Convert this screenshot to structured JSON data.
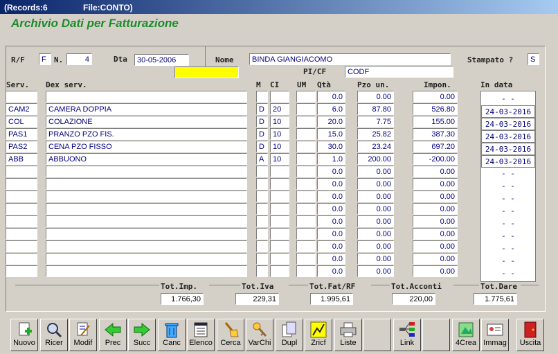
{
  "window": {
    "records": "(Records:6",
    "file": "File:CONTO)"
  },
  "heading": "Archivio Dati per Fatturazione",
  "header": {
    "rf_label": "R/F",
    "rf_value": "F",
    "n_label": "N.",
    "n_value": "4",
    "dta_label": "Dta",
    "dta_value": "30-05-2006",
    "nome_label": "Nome",
    "nome_value": "BINDA GIANGIACOMO",
    "stampato_label": "Stampato ?",
    "stampato_value": "S",
    "picf_label": "PI/CF",
    "picf_value": "CODF"
  },
  "columns": {
    "serv": "Serv.",
    "dex": "Dex serv.",
    "m": "M",
    "ci": "CI",
    "um": "UM",
    "qta": "Qtà",
    "pzo": "Pzo un.",
    "impon": "Impon.",
    "indata": "In data"
  },
  "rows": [
    {
      "serv": "",
      "dex": "",
      "m": "",
      "ci": "",
      "um": "",
      "qta": "0.0",
      "pzo": "0.00",
      "impon": "0.00",
      "date": "-  -"
    },
    {
      "serv": "CAM2",
      "dex": "CAMERA DOPPIA",
      "m": "D",
      "ci": "20",
      "um": "",
      "qta": "6.0",
      "pzo": "87.80",
      "impon": "526.80",
      "date": "24-03-2016"
    },
    {
      "serv": "COL",
      "dex": "COLAZIONE",
      "m": "D",
      "ci": "10",
      "um": "",
      "qta": "20.0",
      "pzo": "7.75",
      "impon": "155.00",
      "date": "24-03-2016"
    },
    {
      "serv": "PAS1",
      "dex": "PRANZO PZO FIS.",
      "m": "D",
      "ci": "10",
      "um": "",
      "qta": "15.0",
      "pzo": "25.82",
      "impon": "387.30",
      "date": "24-03-2016"
    },
    {
      "serv": "PAS2",
      "dex": "CENA PZO FISSO",
      "m": "D",
      "ci": "10",
      "um": "",
      "qta": "30.0",
      "pzo": "23.24",
      "impon": "697.20",
      "date": "24-03-2016"
    },
    {
      "serv": "ABB",
      "dex": "ABBUONO",
      "m": "A",
      "ci": "10",
      "um": "",
      "qta": "1.0",
      "pzo": "200.00",
      "impon": "-200.00",
      "date": "24-03-2016"
    },
    {
      "serv": "",
      "dex": "",
      "m": "",
      "ci": "",
      "um": "",
      "qta": "0.0",
      "pzo": "0.00",
      "impon": "0.00",
      "date": "-  -"
    },
    {
      "serv": "",
      "dex": "",
      "m": "",
      "ci": "",
      "um": "",
      "qta": "0.0",
      "pzo": "0.00",
      "impon": "0.00",
      "date": "-  -"
    },
    {
      "serv": "",
      "dex": "",
      "m": "",
      "ci": "",
      "um": "",
      "qta": "0.0",
      "pzo": "0.00",
      "impon": "0.00",
      "date": "-  -"
    },
    {
      "serv": "",
      "dex": "",
      "m": "",
      "ci": "",
      "um": "",
      "qta": "0.0",
      "pzo": "0.00",
      "impon": "0.00",
      "date": "-  -"
    },
    {
      "serv": "",
      "dex": "",
      "m": "",
      "ci": "",
      "um": "",
      "qta": "0.0",
      "pzo": "0.00",
      "impon": "0.00",
      "date": "-  -"
    },
    {
      "serv": "",
      "dex": "",
      "m": "",
      "ci": "",
      "um": "",
      "qta": "0.0",
      "pzo": "0.00",
      "impon": "0.00",
      "date": "-  -"
    },
    {
      "serv": "",
      "dex": "",
      "m": "",
      "ci": "",
      "um": "",
      "qta": "0.0",
      "pzo": "0.00",
      "impon": "0.00",
      "date": "-  -"
    },
    {
      "serv": "",
      "dex": "",
      "m": "",
      "ci": "",
      "um": "",
      "qta": "0.0",
      "pzo": "0.00",
      "impon": "0.00",
      "date": "-  -"
    },
    {
      "serv": "",
      "dex": "",
      "m": "",
      "ci": "",
      "um": "",
      "qta": "0.0",
      "pzo": "0.00",
      "impon": "0.00",
      "date": "-  -"
    }
  ],
  "totals": {
    "imp_label": "Tot.Imp.",
    "imp": "1.766,30",
    "iva_label": "Tot.Iva",
    "iva": "229,31",
    "fat_label": "Tot.Fat/RF",
    "fat": "1.995,61",
    "acconti_label": "Tot.Acconti",
    "acconti": "220,00",
    "dare_label": "Tot.Dare",
    "dare": "1.775,61"
  },
  "toolbar": [
    {
      "name": "nuovo-button",
      "icon": "new-doc-icon",
      "label": "Nuovo"
    },
    {
      "name": "ricer-button",
      "icon": "search-icon",
      "label": "Ricer"
    },
    {
      "name": "modif-button",
      "icon": "edit-icon",
      "label": "Modif"
    },
    {
      "name": "prec-button",
      "icon": "arrow-left-icon",
      "label": "Prec"
    },
    {
      "name": "succ-button",
      "icon": "arrow-right-icon",
      "label": "Succ"
    },
    {
      "name": "canc-button",
      "icon": "trash-icon",
      "label": "Canc"
    },
    {
      "name": "elenco-button",
      "icon": "list-icon",
      "label": "Elenco"
    },
    {
      "name": "cerca-button",
      "icon": "broom-icon",
      "label": "Cerca"
    },
    {
      "name": "varchi-button",
      "icon": "keys-icon",
      "label": "VarChi"
    },
    {
      "name": "dupl-button",
      "icon": "copy-icon",
      "label": "Dupl"
    },
    {
      "name": "zricf-button",
      "icon": "zricf-icon",
      "label": "Zricf"
    },
    {
      "name": "liste-button",
      "icon": "printer-icon",
      "label": "Liste"
    },
    {
      "name": "blank-button-1",
      "icon": "",
      "label": ""
    },
    {
      "name": "link-button",
      "icon": "link-tree-icon",
      "label": "Link"
    },
    {
      "name": "blank-button-2",
      "icon": "",
      "label": ""
    },
    {
      "name": "4crea-button",
      "icon": "create-icon",
      "label": "4Crea"
    },
    {
      "name": "immag-button",
      "icon": "image-card-icon",
      "label": "Immag"
    },
    {
      "name": "blank-button-3",
      "icon": "",
      "label": ""
    },
    {
      "name": "uscita-button",
      "icon": "exit-door-icon",
      "label": "Uscita"
    }
  ]
}
